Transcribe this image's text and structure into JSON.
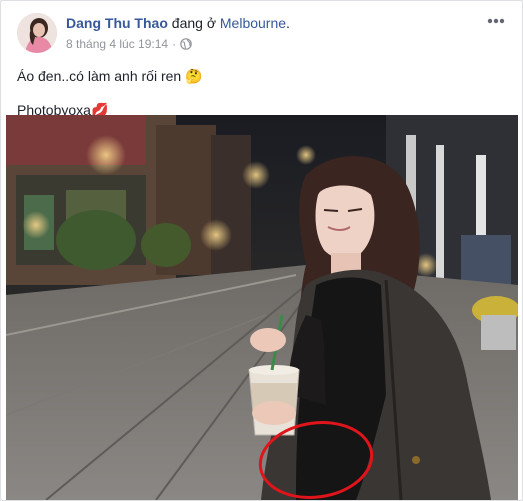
{
  "post": {
    "author": "Dang Thu Thao",
    "status_text": "đang ở",
    "location": "Melbourne",
    "status_end": ".",
    "timestamp": "8 tháng 4 lúc 19:14",
    "timestamp_separator": "·",
    "privacy_icon": "globe-icon",
    "options_icon": "more-horizontal-icon",
    "caption_line_1": "Áo đen..có làm anh rối ren 🤔",
    "caption_line_2": "Photobyoxa💋",
    "photo_annotation": "red-circle-highlight"
  },
  "colors": {
    "link": "#385898",
    "meta": "#90949c",
    "text": "#1d2129",
    "annotation": "#e0141b"
  }
}
